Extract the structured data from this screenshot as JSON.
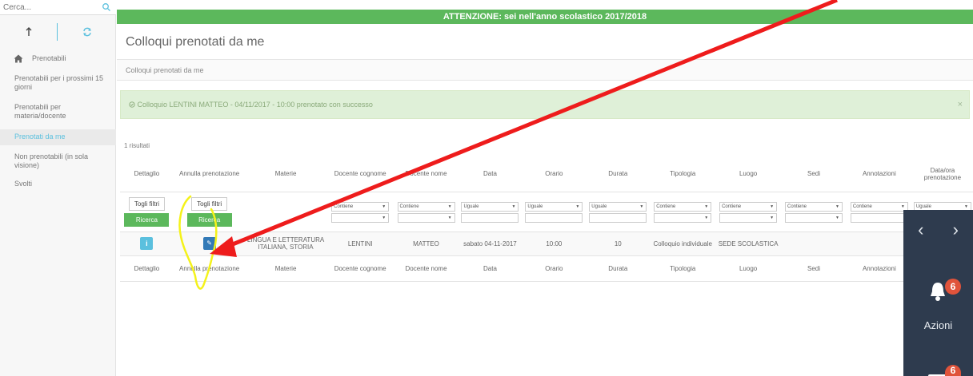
{
  "search": {
    "placeholder": "Cerca..."
  },
  "sidebar": {
    "items": [
      {
        "label": "Prenotabili"
      },
      {
        "label": "Prenotabili per i prossimi 15 giorni"
      },
      {
        "label": "Prenotabili per materia/docente"
      },
      {
        "label": "Prenotati da me"
      },
      {
        "label": "Non prenotabili (in sola visione)"
      },
      {
        "label": "Svolti"
      }
    ]
  },
  "banner": {
    "text": "ATTENZIONE: sei nell'anno scolastico 2017/2018"
  },
  "page": {
    "title": "Colloqui prenotati da me",
    "breadcrumb": "Colloqui prenotati da me",
    "alert": "Colloquio LENTINI MATTEO - 04/11/2017 - 10:00 prenotato con successo",
    "alert_close": "×",
    "results": "1 risultati"
  },
  "table": {
    "headers": [
      "Dettaglio",
      "Annulla prenotazione",
      "Materie",
      "Docente cognome",
      "Docente nome",
      "Data",
      "Orario",
      "Durata",
      "Tipologia",
      "Luogo",
      "Sedi",
      "Annotazioni",
      "Data/ora prenotazione"
    ],
    "footer": [
      "Dettaglio",
      "Annulla prenotazione",
      "Materie",
      "Docente cognome",
      "Docente nome",
      "Data",
      "Orario",
      "Durata",
      "Tipologia",
      "Luogo",
      "Sedi",
      "Annotazioni"
    ],
    "filters": {
      "clear_label": "Togli filtri",
      "search_label": "Ricerca",
      "contains": "Contiene",
      "equals": "Uguale"
    },
    "row": {
      "materie": "LINGUA E LETTERATURA ITALIANA, STORIA",
      "cognome": "LENTINI",
      "nome": "MATTEO",
      "data": "sabato 04-11-2017",
      "orario": "10:00",
      "durata": "10",
      "tipologia": "Colloquio individuale",
      "luogo": "SEDE SCOLASTICA",
      "info_icon": "i",
      "edit_icon": "✎"
    }
  },
  "dock": {
    "prev": "‹",
    "next": "›",
    "azioni_label": "Azioni",
    "badge_count": "6",
    "badge_count2": "6"
  },
  "colors": {
    "green": "#5cb85c",
    "info": "#5bc0de",
    "primary": "#337ab7",
    "dock": "#2e3b4e",
    "badge": "#e0533b",
    "arrow": "#ee1c1c",
    "highlight": "#f4f21a"
  }
}
